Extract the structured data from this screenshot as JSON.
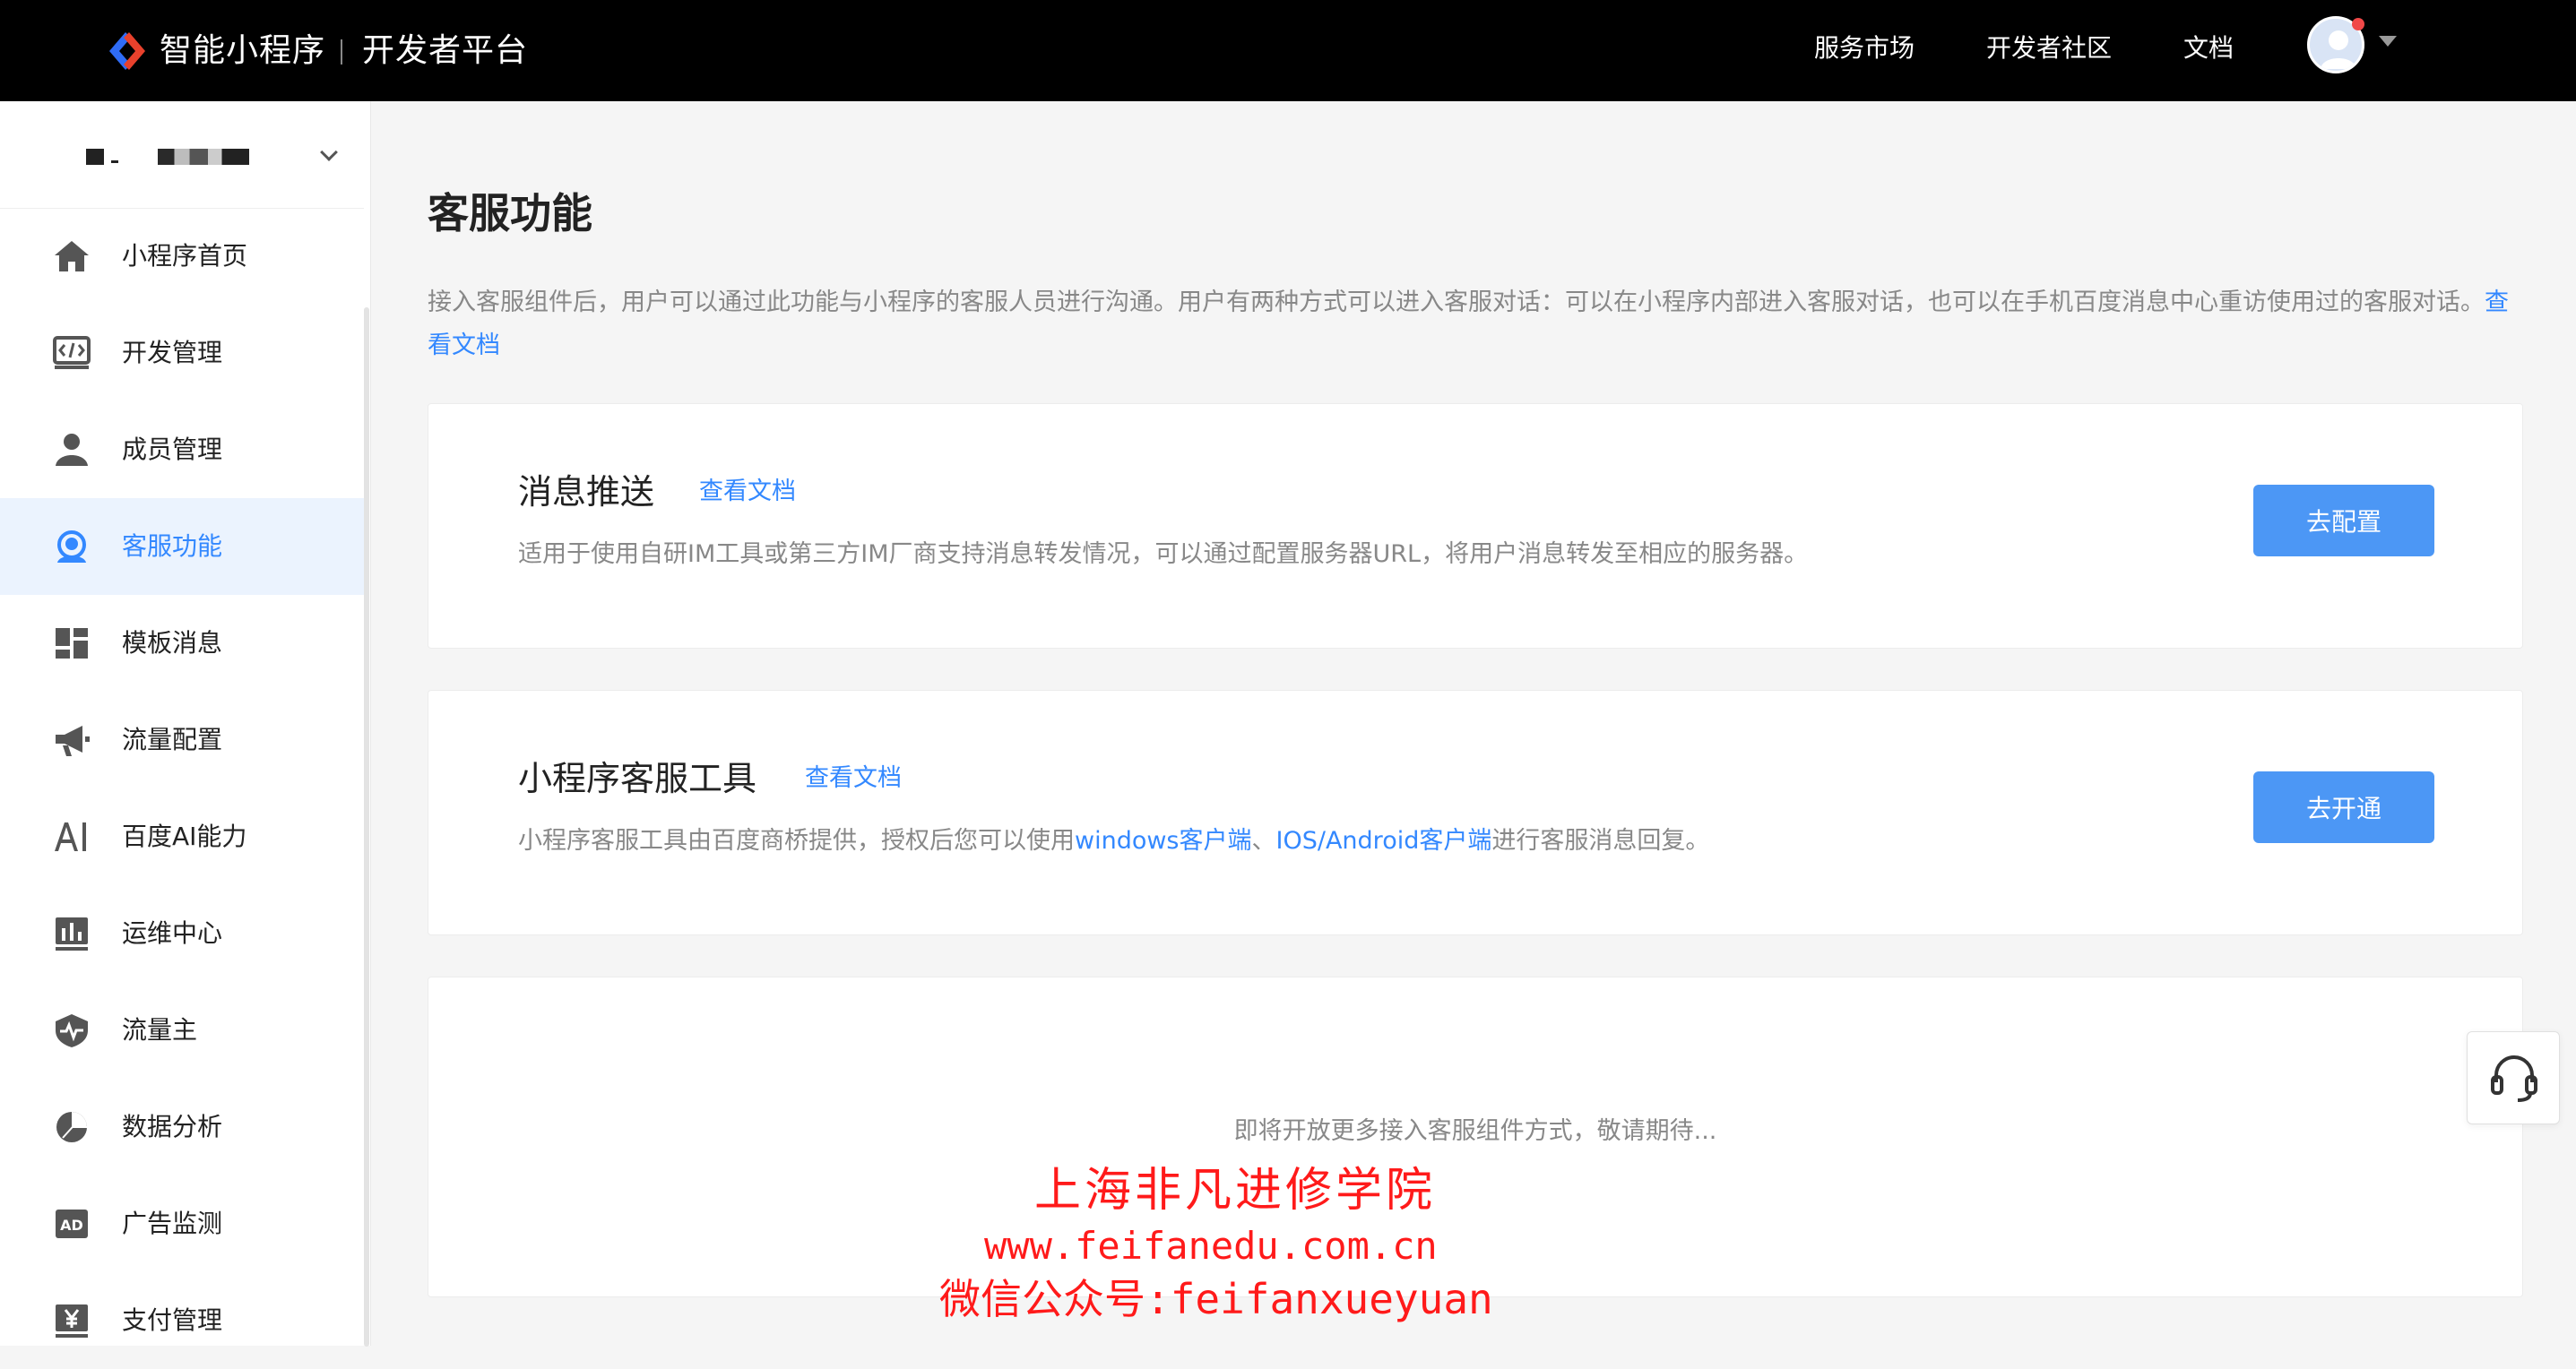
{
  "header": {
    "brand": "智能小程序",
    "subtitle": "开发者平台",
    "nav": [
      {
        "label": "服务市场"
      },
      {
        "label": "开发者社区"
      },
      {
        "label": "文档"
      }
    ]
  },
  "sidebar": {
    "items": [
      {
        "label": "小程序首页",
        "icon": "home-icon"
      },
      {
        "label": "开发管理",
        "icon": "code-icon"
      },
      {
        "label": "成员管理",
        "icon": "user-icon"
      },
      {
        "label": "客服功能",
        "icon": "customer-service-icon",
        "active": true
      },
      {
        "label": "模板消息",
        "icon": "template-icon"
      },
      {
        "label": "流量配置",
        "icon": "megaphone-icon"
      },
      {
        "label": "百度AI能力",
        "icon": "ai-icon"
      },
      {
        "label": "运维中心",
        "icon": "bar-chart-icon"
      },
      {
        "label": "流量主",
        "icon": "shield-pulse-icon"
      },
      {
        "label": "数据分析",
        "icon": "pie-chart-icon"
      },
      {
        "label": "广告监测",
        "icon": "ad-icon"
      },
      {
        "label": "支付管理",
        "icon": "yen-icon"
      }
    ]
  },
  "main": {
    "title": "客服功能",
    "description": "接入客服组件后，用户可以通过此功能与小程序的客服人员进行沟通。用户有两种方式可以进入客服对话：可以在小程序内部进入客服对话，也可以在手机百度消息中心重访使用过的客服对话。",
    "doc_link": "查看文档",
    "cards": [
      {
        "title": "消息推送",
        "doc_link": "查看文档",
        "description": "适用于使用自研IM工具或第三方IM厂商支持消息转发情况，可以通过配置服务器URL，将用户消息转发至相应的服务器。",
        "button": "去配置"
      },
      {
        "title": "小程序客服工具",
        "doc_link": "查看文档",
        "desc_prefix": "小程序客服工具由百度商桥提供，授权后您可以使用",
        "desc_link1": "windows客户端",
        "desc_sep": "、",
        "desc_link2": "IOS/Android客户端",
        "desc_suffix": "进行客服消息回复。",
        "button": "去开通"
      }
    ],
    "coming_soon": "即将开放更多接入客服组件方式，敬请期待..."
  },
  "watermark": {
    "line1": "上海非凡进修学院",
    "line2": "www.feifanedu.com.cn",
    "line3": "微信公众号:feifanxueyuan"
  },
  "colors": {
    "accent": "#3388ff",
    "button": "#4c97f5",
    "watermark": "#ff1a1a"
  }
}
